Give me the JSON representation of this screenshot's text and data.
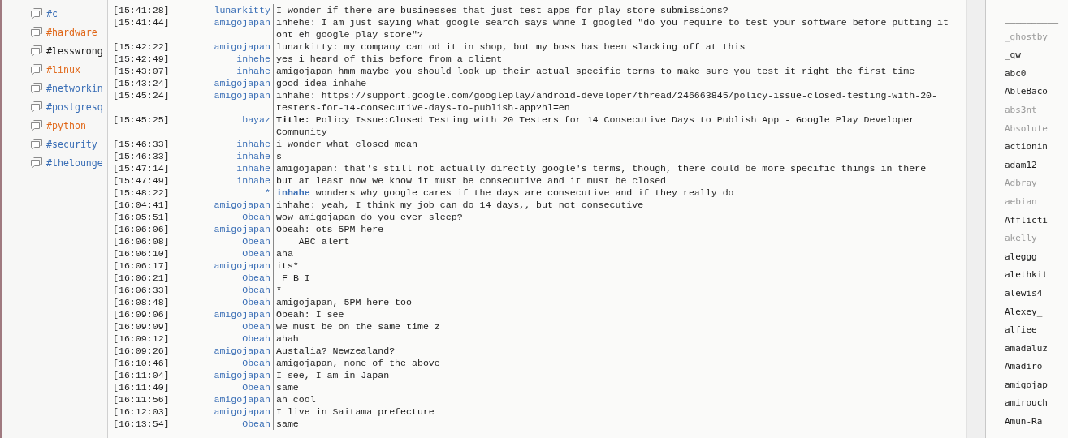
{
  "channels": [
    {
      "name": "#c",
      "color": "#3b6fb6"
    },
    {
      "name": "#hardware",
      "color": "#e0681a"
    },
    {
      "name": "#lesswrong",
      "color": "#222222"
    },
    {
      "name": "#linux",
      "color": "#e0681a"
    },
    {
      "name": "#networkin",
      "color": "#3b6fb6"
    },
    {
      "name": "#postgresq",
      "color": "#3b6fb6"
    },
    {
      "name": "#python",
      "color": "#e0681a"
    },
    {
      "name": "#security",
      "color": "#3b6fb6"
    },
    {
      "name": "#thelounge",
      "color": "#3b6fb6"
    }
  ],
  "messages": [
    {
      "kind": "message",
      "time": "[15:41:28]",
      "nick": "lunarkitty",
      "text": "I wonder if there are businesses that just test apps for play store submissions?"
    },
    {
      "kind": "message",
      "time": "[15:41:44]",
      "nick": "amigojapan",
      "text": "inhehe: I am just saying what google search says whne I googled \"do you require to test your software before putting it ont eh google play store\"?"
    },
    {
      "kind": "message",
      "time": "[15:42:22]",
      "nick": "amigojapan",
      "text": "lunarkitty: my company can od it in shop, but my boss has been slacking off at this"
    },
    {
      "kind": "message",
      "time": "[15:42:49]",
      "nick": "inhehe",
      "text": "yes i heard of this before from a client"
    },
    {
      "kind": "message",
      "time": "[15:43:07]",
      "nick": "inhahe",
      "text": "amigojapan hmm maybe you should look up their actual specific terms to make sure you test it right the first time"
    },
    {
      "kind": "message",
      "time": "[15:43:24]",
      "nick": "amigojapan",
      "text": "good idea inhahe"
    },
    {
      "kind": "message",
      "time": "[15:45:24]",
      "nick": "amigojapan",
      "text": "inhahe: https://support.google.com/googleplay/android-developer/thread/246663845/policy-issue-closed-testing-with-20-testers-for-14-consecutive-days-to-publish-app?hl=en"
    },
    {
      "kind": "message",
      "time": "[15:45:25]",
      "nick": "bayaz",
      "text": "**Title:** Policy Issue:Closed Testing with 20 Testers for 14 Consecutive Days to Publish App - Google Play Developer Community"
    },
    {
      "kind": "message",
      "time": "[15:46:33]",
      "nick": "inhahe",
      "text": "i wonder what closed mean"
    },
    {
      "kind": "message",
      "time": "[15:46:33]",
      "nick": "inhahe",
      "text": "s"
    },
    {
      "kind": "message",
      "time": "[15:47:14]",
      "nick": "inhahe",
      "text": "amigojapan: that's still not actually directly google's terms, though, there could be more specific things in there"
    },
    {
      "kind": "message",
      "time": "[15:47:49]",
      "nick": "inhahe",
      "text": "but at least now we know it must be consecutive and it must be closed"
    },
    {
      "kind": "action",
      "time": "[15:48:22]",
      "nick": "*",
      "actor": "inhahe",
      "text": "wonders why google cares if the days are consecutive and if they really do"
    },
    {
      "kind": "message",
      "time": "[16:04:41]",
      "nick": "amigojapan",
      "text": "inhahe: yeah, I think my job can do 14 days,, but not consecutive"
    },
    {
      "kind": "message",
      "time": "[16:05:51]",
      "nick": "Obeah",
      "text": "wow amigojapan do you ever sleep?"
    },
    {
      "kind": "message",
      "time": "[16:06:06]",
      "nick": "amigojapan",
      "text": "Obeah: ots 5PM here"
    },
    {
      "kind": "message",
      "time": "[16:06:08]",
      "nick": "Obeah",
      "text": "    ABC alert"
    },
    {
      "kind": "message",
      "time": "[16:06:10]",
      "nick": "Obeah",
      "text": "aha"
    },
    {
      "kind": "message",
      "time": "[16:06:17]",
      "nick": "amigojapan",
      "text": "its*"
    },
    {
      "kind": "message",
      "time": "[16:06:21]",
      "nick": "Obeah",
      "text": " F B I"
    },
    {
      "kind": "message",
      "time": "[16:06:33]",
      "nick": "Obeah",
      "text": "*"
    },
    {
      "kind": "message",
      "time": "[16:08:48]",
      "nick": "Obeah",
      "text": "amigojapan, 5PM here too"
    },
    {
      "kind": "message",
      "time": "[16:09:06]",
      "nick": "amigojapan",
      "text": "Obeah: I see"
    },
    {
      "kind": "message",
      "time": "[16:09:09]",
      "nick": "Obeah",
      "text": "we must be on the same time z"
    },
    {
      "kind": "message",
      "time": "[16:09:12]",
      "nick": "Obeah",
      "text": "ahah"
    },
    {
      "kind": "message",
      "time": "[16:09:26]",
      "nick": "amigojapan",
      "text": "Austalia? Newzealand?"
    },
    {
      "kind": "message",
      "time": "[16:10:46]",
      "nick": "Obeah",
      "text": "amigojapan, none of the above"
    },
    {
      "kind": "message",
      "time": "[16:11:04]",
      "nick": "amigojapan",
      "text": "I see, I am in Japan"
    },
    {
      "kind": "message",
      "time": "[16:11:40]",
      "nick": "Obeah",
      "text": "same"
    },
    {
      "kind": "message",
      "time": "[16:11:56]",
      "nick": "amigojapan",
      "text": "ah cool"
    },
    {
      "kind": "message",
      "time": "[16:12:03]",
      "nick": "amigojapan",
      "text": "I live in Saitama prefecture"
    },
    {
      "kind": "message",
      "time": "[16:13:54]",
      "nick": "Obeah",
      "text": "same"
    }
  ],
  "users": [
    {
      "nick": "__________",
      "away": false
    },
    {
      "nick": "_ghostby",
      "away": true
    },
    {
      "nick": "_qw",
      "away": false
    },
    {
      "nick": "abc0",
      "away": false
    },
    {
      "nick": "AbleBaco",
      "away": false
    },
    {
      "nick": "abs3nt",
      "away": true
    },
    {
      "nick": "Absolute",
      "away": true
    },
    {
      "nick": "actionin",
      "away": false
    },
    {
      "nick": "adam12",
      "away": false
    },
    {
      "nick": "Adbray",
      "away": true
    },
    {
      "nick": "aebian",
      "away": true
    },
    {
      "nick": "Afflicti",
      "away": false
    },
    {
      "nick": "akelly",
      "away": true
    },
    {
      "nick": "aleggg",
      "away": false
    },
    {
      "nick": "alethkit",
      "away": false
    },
    {
      "nick": "alewis4",
      "away": false
    },
    {
      "nick": "Alexey_",
      "away": false
    },
    {
      "nick": "alfiee",
      "away": false
    },
    {
      "nick": "amadaluz",
      "away": false
    },
    {
      "nick": "Amadiro_",
      "away": false
    },
    {
      "nick": "amigojap",
      "away": false
    },
    {
      "nick": "amirouch",
      "away": false
    },
    {
      "nick": "Amun-Ra",
      "away": false
    }
  ]
}
